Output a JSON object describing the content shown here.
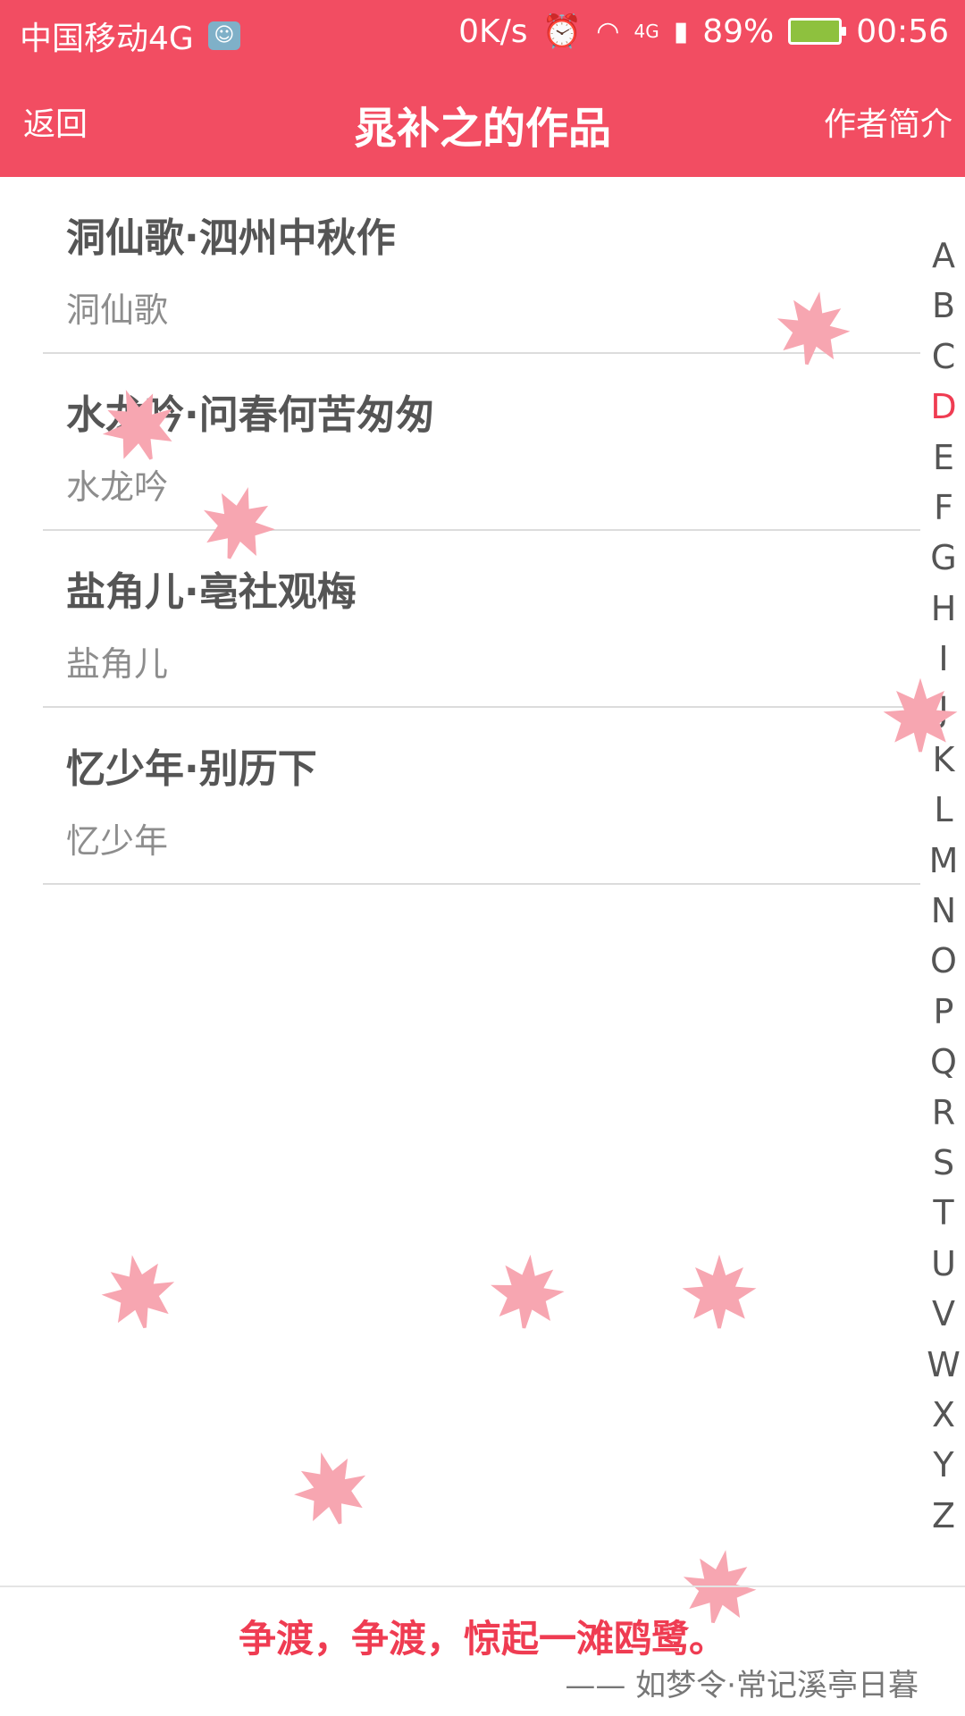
{
  "status_bar": {
    "carrier": "中国移动4G",
    "speed": "0K/s",
    "network": "4G",
    "battery": "89%",
    "time": "00:56"
  },
  "header": {
    "back_label": "返回",
    "title": "晁补之的作品",
    "author_intro_label": "作者简介"
  },
  "works": [
    {
      "title": "洞仙歌·泗州中秋作",
      "subtitle": "洞仙歌"
    },
    {
      "title": "水龙吟·问春何苦匆匆",
      "subtitle": "水龙吟"
    },
    {
      "title": "盐角儿·亳社观梅",
      "subtitle": "盐角儿"
    },
    {
      "title": "忆少年·别历下",
      "subtitle": "忆少年"
    }
  ],
  "index": {
    "letters": [
      "A",
      "B",
      "C",
      "D",
      "E",
      "F",
      "G",
      "H",
      "I",
      "J",
      "K",
      "L",
      "M",
      "N",
      "O",
      "P",
      "Q",
      "R",
      "S",
      "T",
      "U",
      "V",
      "W",
      "X",
      "Y",
      "Z"
    ],
    "active": "D"
  },
  "footer": {
    "quote": "争渡，争渡，惊起一滩鸥鹭。",
    "source": "—— 如梦令·常记溪亭日暮"
  },
  "colors": {
    "accent": "#f24d62",
    "active_letter": "#ef3c52",
    "leaf": "#f7a6b1"
  }
}
